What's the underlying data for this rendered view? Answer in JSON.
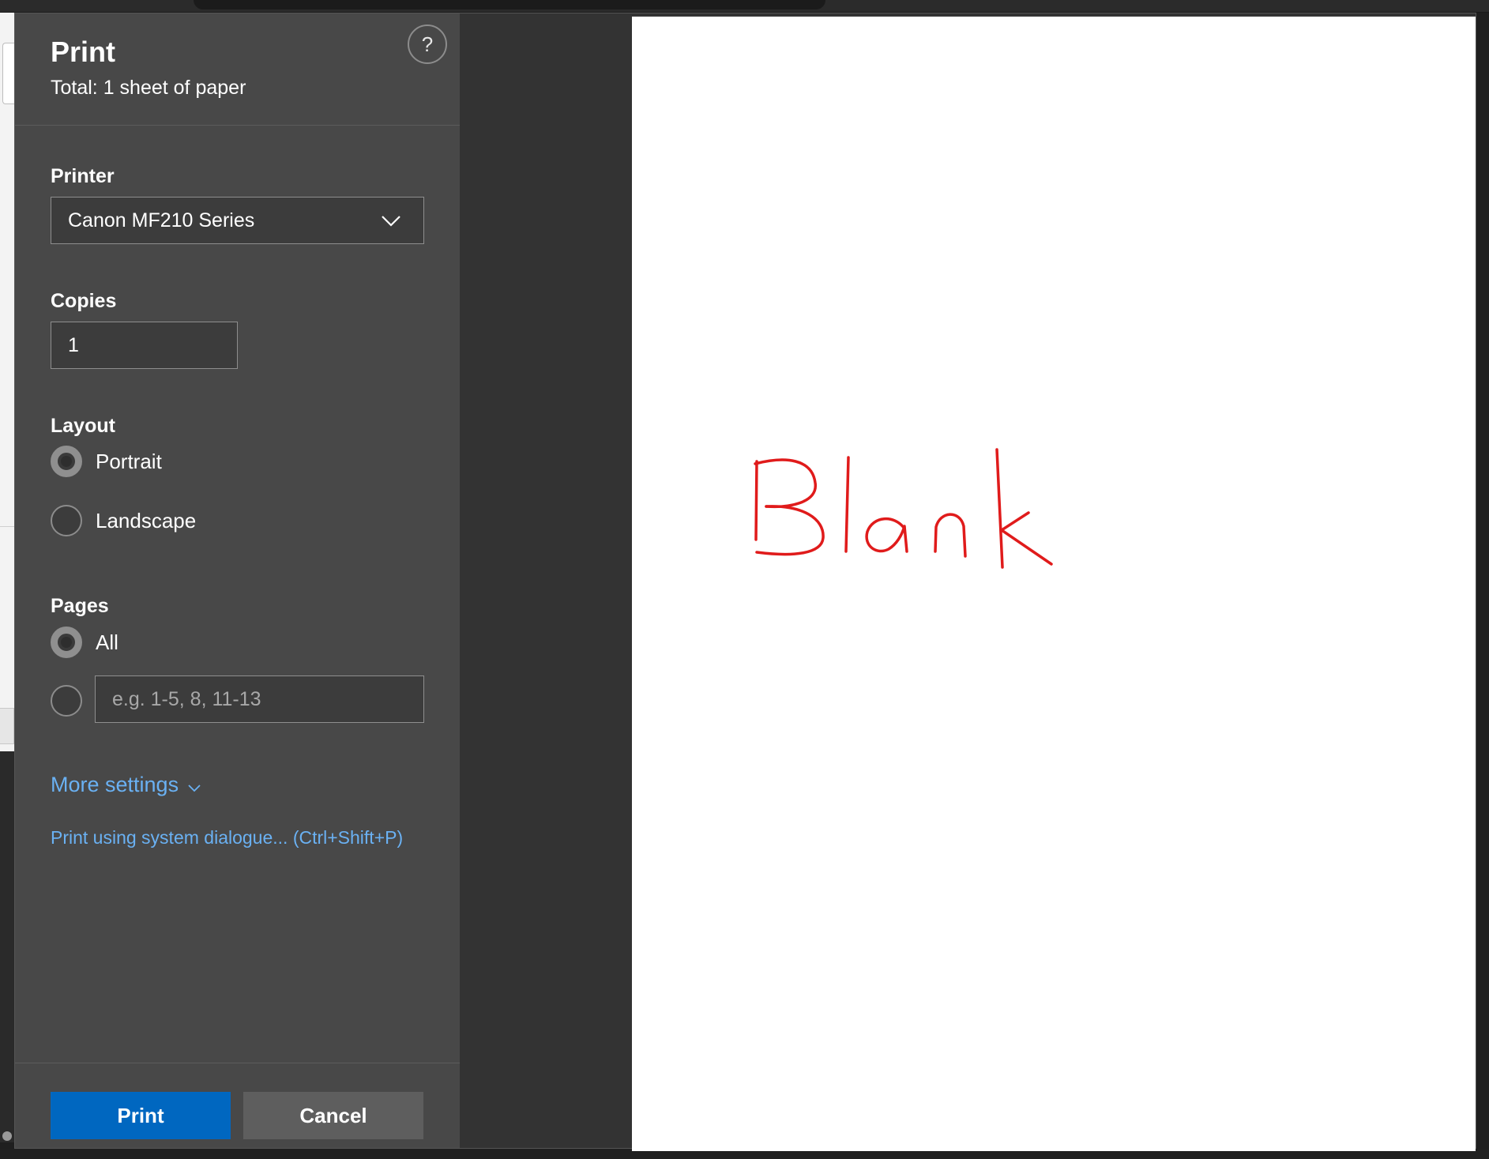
{
  "dialog": {
    "title": "Print",
    "subtitle": "Total: 1 sheet of paper",
    "help_label": "?"
  },
  "printer": {
    "label": "Printer",
    "selected": "Canon MF210 Series"
  },
  "copies": {
    "label": "Copies",
    "value": "1"
  },
  "layout": {
    "label": "Layout",
    "options": [
      "Portrait",
      "Landscape"
    ],
    "selected": "Portrait"
  },
  "pages": {
    "label": "Pages",
    "all_label": "All",
    "selected": "All",
    "custom_placeholder": "e.g. 1-5, 8, 11-13"
  },
  "links": {
    "more_settings": "More settings",
    "system_dialog": "Print using system dialogue... (Ctrl+Shift+P)"
  },
  "buttons": {
    "print": "Print",
    "cancel": "Cancel"
  },
  "preview": {
    "handwritten_text": "Blank",
    "ink_color": "#e01b1b"
  },
  "colors": {
    "accent": "#0067c0",
    "link": "#6ab1f3",
    "panel": "#484848"
  }
}
